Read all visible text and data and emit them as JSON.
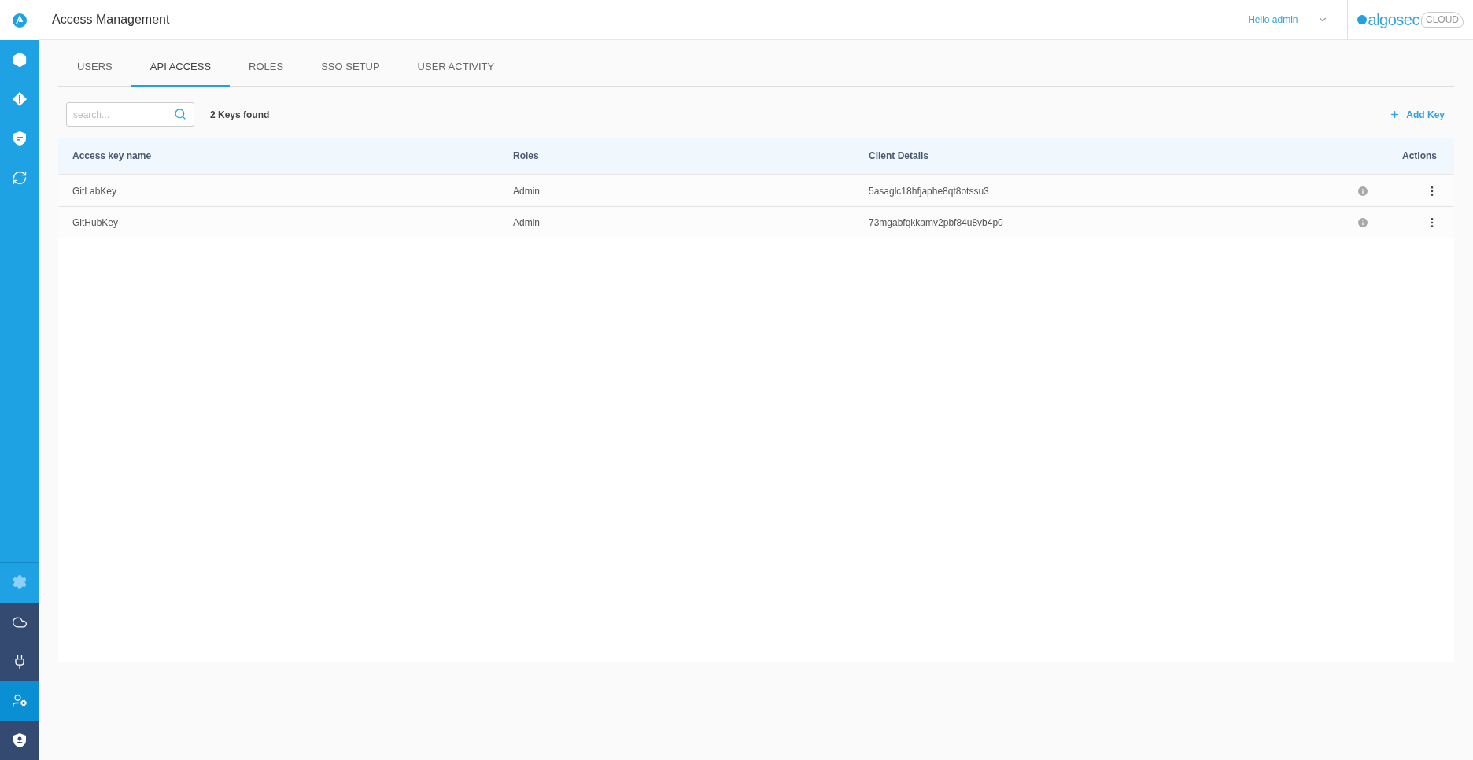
{
  "header": {
    "title": "Access Management",
    "user_menu": "Hello admin",
    "logo": {
      "brand": "algosec",
      "product": "CLOUD"
    }
  },
  "sidebar": {
    "top_items": [
      {
        "selected": false
      },
      {
        "selected": false
      },
      {
        "selected": false
      },
      {
        "selected": false
      }
    ],
    "settings_item": {
      "selected": false
    },
    "bottom_items": [
      {
        "selected": false
      },
      {
        "selected": false
      },
      {
        "selected": true
      },
      {
        "selected": false
      }
    ]
  },
  "tabs": [
    {
      "label": "USERS",
      "selected": false
    },
    {
      "label": "API ACCESS",
      "selected": true
    },
    {
      "label": "ROLES",
      "selected": false
    },
    {
      "label": "SSO SETUP",
      "selected": false
    },
    {
      "label": "USER ACTIVITY",
      "selected": false
    }
  ],
  "toolbar": {
    "search": {
      "placeholder": "search..."
    },
    "count": "2 Keys found",
    "add_button": "Add Key"
  },
  "table": {
    "columns": [
      "Access key name",
      "Roles",
      "Client Details",
      "Actions"
    ],
    "rows": [
      {
        "name": "GitLabKey",
        "role": "Admin",
        "client": "5asaglc18hfjaphe8qt8otssu3"
      },
      {
        "name": "GitHubKey",
        "role": "Admin",
        "client": "73mgabfqkkamv2pbf84u8vb4p0"
      }
    ]
  }
}
